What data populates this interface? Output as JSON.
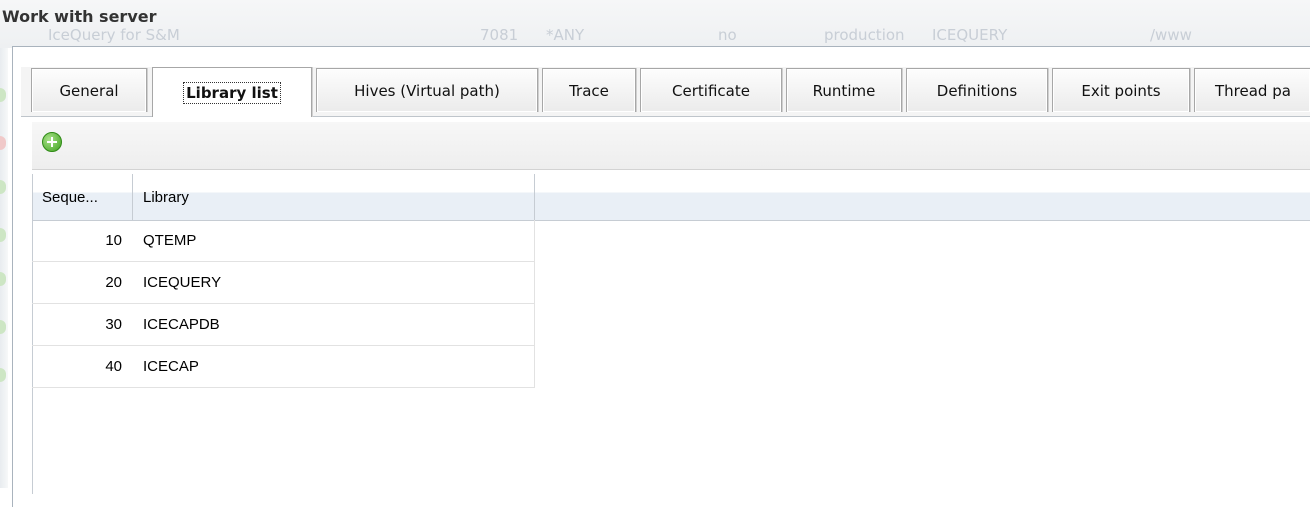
{
  "dialog": {
    "title": "Work with server"
  },
  "background_row": {
    "cells": [
      "IceQuery for S&M",
      "7081",
      "*ANY",
      "no",
      "production",
      "ICEQUERY",
      "/www"
    ]
  },
  "tabs": [
    {
      "label": "General",
      "active": false
    },
    {
      "label": "Library list",
      "active": true
    },
    {
      "label": "Hives (Virtual path)",
      "active": false
    },
    {
      "label": "Trace",
      "active": false
    },
    {
      "label": "Certificate",
      "active": false
    },
    {
      "label": "Runtime",
      "active": false
    },
    {
      "label": "Definitions",
      "active": false
    },
    {
      "label": "Exit points",
      "active": false
    },
    {
      "label": "Thread pa",
      "active": false
    }
  ],
  "toolbar": {
    "add_icon": "add-circle-icon"
  },
  "grid": {
    "columns": [
      "Seque...",
      "Library"
    ],
    "rows": [
      {
        "sequence": "10",
        "library": "QTEMP"
      },
      {
        "sequence": "20",
        "library": "ICEQUERY"
      },
      {
        "sequence": "30",
        "library": "ICECAPDB"
      },
      {
        "sequence": "40",
        "library": "ICECAP"
      }
    ]
  },
  "colors": {
    "accent_green": "#3ea21e",
    "header_bg": "#e9eff6"
  }
}
